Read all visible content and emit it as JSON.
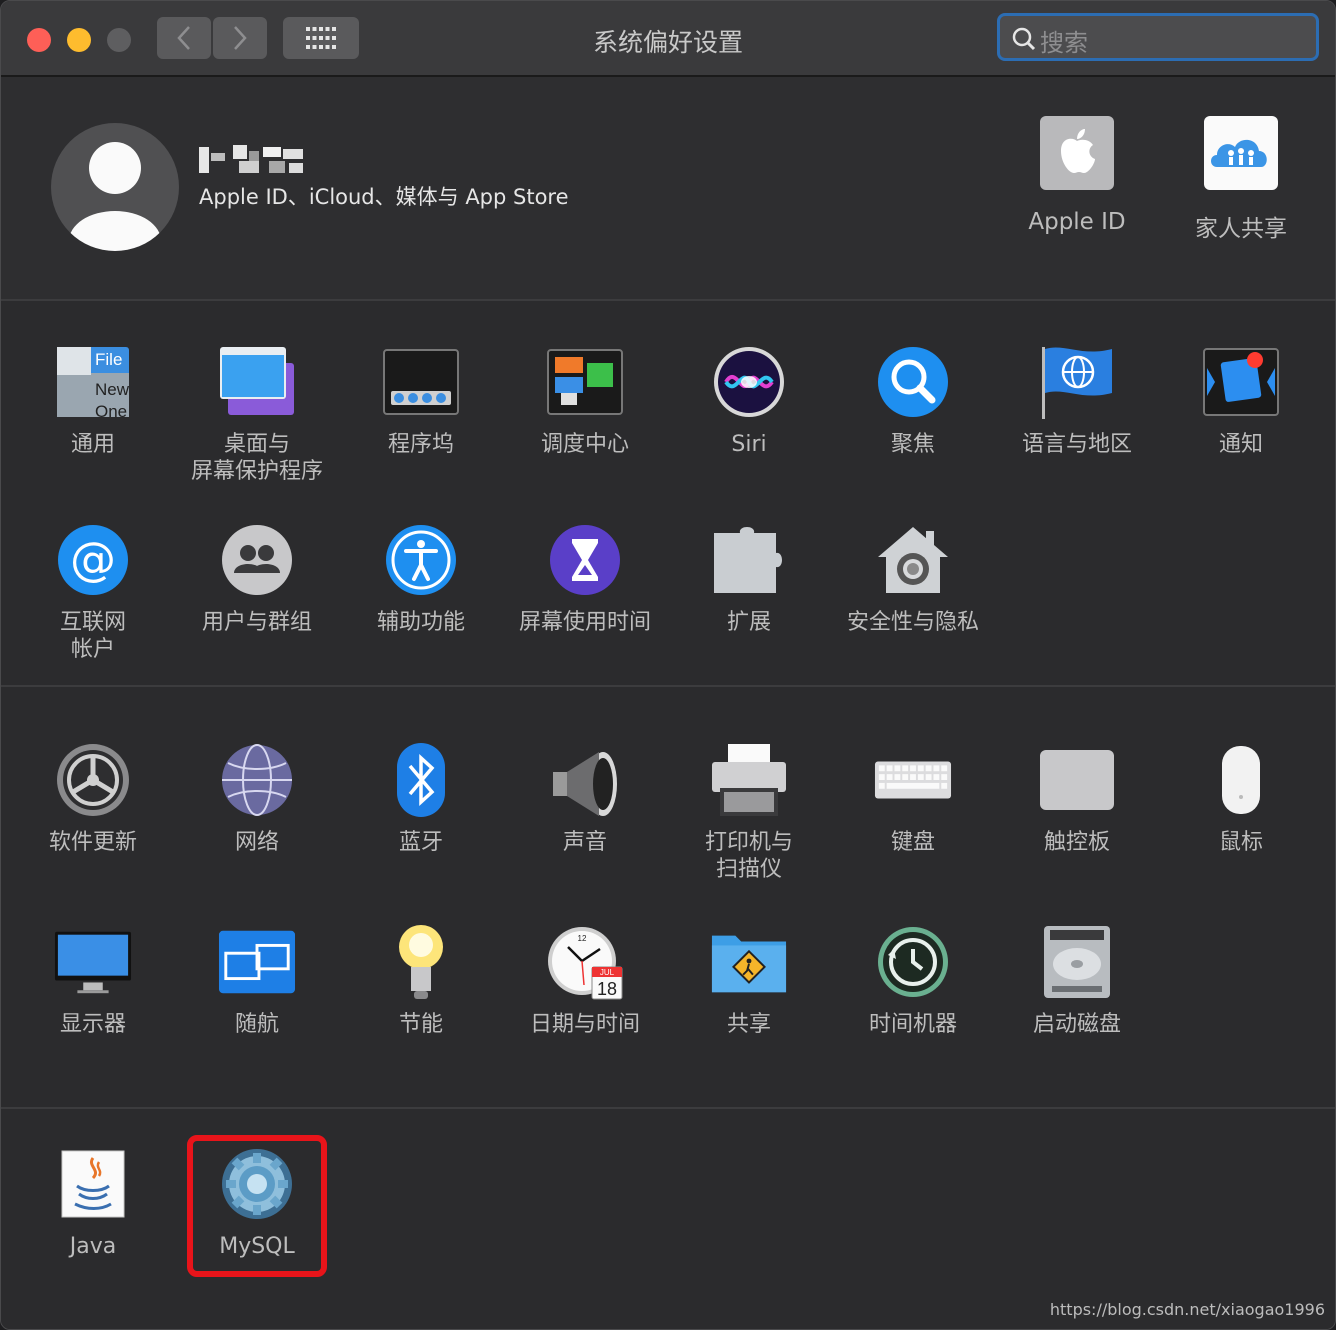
{
  "window": {
    "title": "系统偏好设置"
  },
  "search": {
    "placeholder": "搜索"
  },
  "profile": {
    "subtitle": "Apple ID、iCloud、媒体与 App Store",
    "top_items": [
      {
        "label": "Apple ID",
        "icon": "apple-logo-icon"
      },
      {
        "label": "家人共享",
        "icon": "family-sharing-icon"
      }
    ]
  },
  "section1": [
    {
      "label": "通用",
      "icon": "general-icon"
    },
    {
      "label": "桌面与\n屏幕保护程序",
      "icon": "desktop-screensaver-icon"
    },
    {
      "label": "程序坞",
      "icon": "dock-icon"
    },
    {
      "label": "调度中心",
      "icon": "mission-control-icon"
    },
    {
      "label": "Siri",
      "icon": "siri-icon"
    },
    {
      "label": "聚焦",
      "icon": "spotlight-icon"
    },
    {
      "label": "语言与地区",
      "icon": "language-region-icon"
    },
    {
      "label": "通知",
      "icon": "notifications-icon"
    },
    {
      "label": "互联网\n帐户",
      "icon": "internet-accounts-icon"
    },
    {
      "label": "用户与群组",
      "icon": "users-groups-icon"
    },
    {
      "label": "辅助功能",
      "icon": "accessibility-icon"
    },
    {
      "label": "屏幕使用时间",
      "icon": "screen-time-icon"
    },
    {
      "label": "扩展",
      "icon": "extensions-icon"
    },
    {
      "label": "安全性与隐私",
      "icon": "security-privacy-icon"
    }
  ],
  "section2": [
    {
      "label": "软件更新",
      "icon": "software-update-icon"
    },
    {
      "label": "网络",
      "icon": "network-icon"
    },
    {
      "label": "蓝牙",
      "icon": "bluetooth-icon"
    },
    {
      "label": "声音",
      "icon": "sound-icon"
    },
    {
      "label": "打印机与\n扫描仪",
      "icon": "printer-scanner-icon"
    },
    {
      "label": "键盘",
      "icon": "keyboard-icon"
    },
    {
      "label": "触控板",
      "icon": "trackpad-icon"
    },
    {
      "label": "鼠标",
      "icon": "mouse-icon"
    },
    {
      "label": "显示器",
      "icon": "displays-icon"
    },
    {
      "label": "随航",
      "icon": "sidecar-icon"
    },
    {
      "label": "节能",
      "icon": "energy-saver-icon"
    },
    {
      "label": "日期与时间",
      "icon": "date-time-icon"
    },
    {
      "label": "共享",
      "icon": "sharing-icon"
    },
    {
      "label": "时间机器",
      "icon": "time-machine-icon"
    },
    {
      "label": "启动磁盘",
      "icon": "startup-disk-icon"
    }
  ],
  "section3": [
    {
      "label": "Java",
      "icon": "java-icon"
    },
    {
      "label": "MySQL",
      "icon": "mysql-icon"
    }
  ],
  "icon_text": {
    "general_file": "File",
    "general_new": "New",
    "general_one": "One",
    "calendar_month": "JUL",
    "calendar_day": "18",
    "clock_12": "12"
  },
  "colors": {
    "highlight": "#e8141a",
    "search_border": "#2c6db3"
  },
  "watermark": "https://blog.csdn.net/xiaogao1996"
}
